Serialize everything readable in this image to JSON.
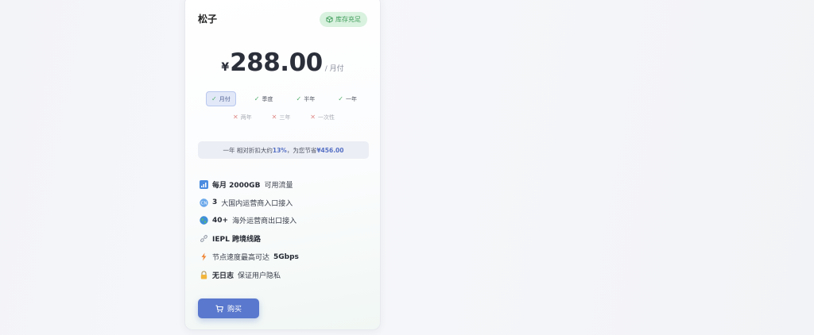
{
  "plan": {
    "name": "松子",
    "stock_label": "库存充足",
    "currency": "¥",
    "price": "288.00",
    "period": "/ 月付"
  },
  "billing_cycles": {
    "available": [
      {
        "label": "月付",
        "active": true
      },
      {
        "label": "季度",
        "active": false
      },
      {
        "label": "半年",
        "active": false
      },
      {
        "label": "一年",
        "active": false
      }
    ],
    "unavailable": [
      {
        "label": "两年"
      },
      {
        "label": "三年"
      },
      {
        "label": "一次性"
      }
    ]
  },
  "savings": {
    "prefix": "一年 相对折扣大约 ",
    "percent": "13%",
    "middle": "，为您节省 ",
    "amount": "¥456.00"
  },
  "features": [
    {
      "icon": "signal-bars-icon",
      "bold": "每月 2000GB",
      "text": " 可用流量"
    },
    {
      "icon": "china-flag-icon",
      "bold": "3",
      "text": " 大国内运营商入口接入"
    },
    {
      "icon": "globe-icon",
      "bold": "40+",
      "text": " 海外运营商出口接入"
    },
    {
      "icon": "link-icon",
      "bold": "IEPL 跨境线路",
      "text": ""
    },
    {
      "icon": "lightning-icon",
      "bold": "",
      "text": "节点速度最高可达 ",
      "bold_after": "5Gbps"
    },
    {
      "icon": "lock-icon",
      "bold": "无日志",
      "text": " 保证用户隐私"
    }
  ],
  "buy_button": {
    "label": "购买"
  },
  "colors": {
    "accent": "#5a78cd",
    "stock_bg": "#d9f1df",
    "stock_text": "#3f9d5a",
    "check": "#4fae6a",
    "cross": "#e08a8a"
  }
}
